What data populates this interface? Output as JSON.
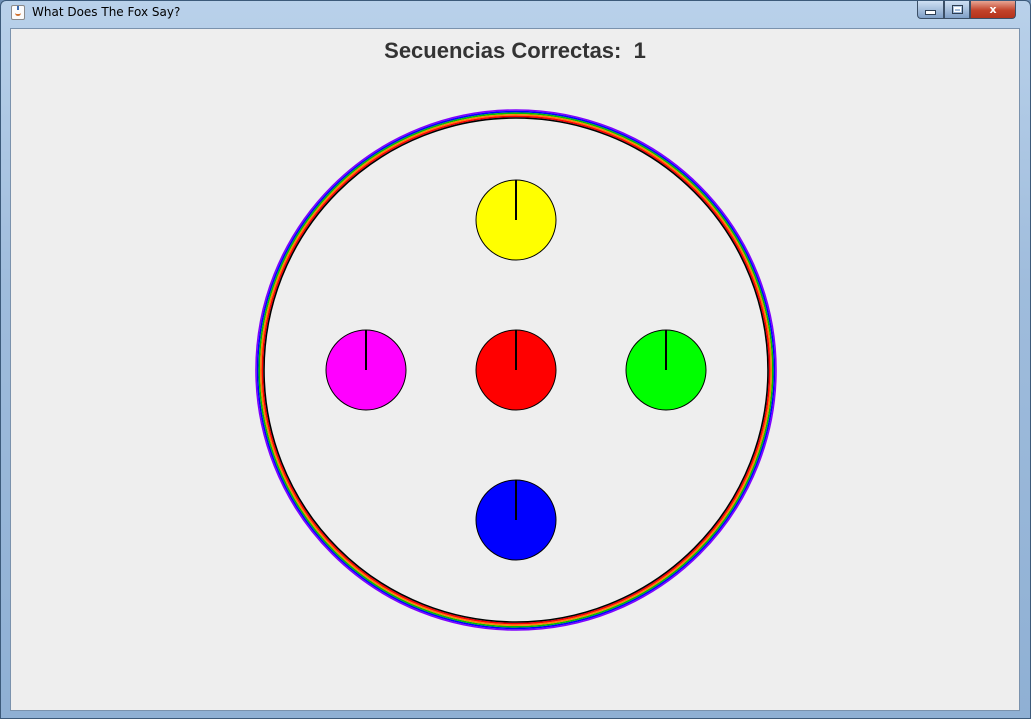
{
  "window": {
    "title": "What Does The Fox Say?",
    "controls": {
      "minimize_icon": "minimize-icon",
      "maximize_icon": "maximize-icon",
      "close_icon": "close-icon",
      "close_glyph": "x"
    }
  },
  "game": {
    "score_label": "Secuencias Correctas:",
    "score_value": "1",
    "ring_colors": [
      "#8000ff",
      "#0000ff",
      "#00c000",
      "#ff8000",
      "#ff0000",
      "#000000"
    ],
    "buttons": [
      {
        "name": "yellow-button",
        "color": "#ffff00"
      },
      {
        "name": "magenta-button",
        "color": "#ff00ff"
      },
      {
        "name": "red-button",
        "color": "#ff0000"
      },
      {
        "name": "green-button",
        "color": "#00ff00"
      },
      {
        "name": "blue-button",
        "color": "#0000ff"
      }
    ]
  }
}
